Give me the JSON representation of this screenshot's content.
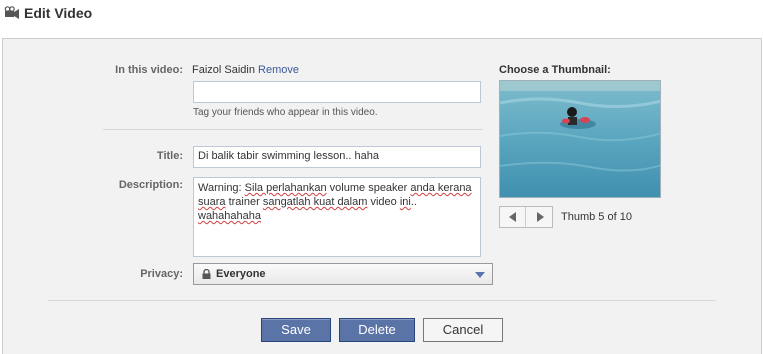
{
  "header": {
    "title": "Edit Video",
    "icon": "video-camera-icon"
  },
  "tagging": {
    "label": "In this video:",
    "tagged_name": "Faizol Saidin",
    "remove_link": "Remove",
    "input_value": "",
    "hint": "Tag your friends who appear in this video."
  },
  "title_field": {
    "label": "Title:",
    "value": "Di balik tabir swimming lesson.. haha"
  },
  "description_field": {
    "label": "Description:",
    "line1_a": "Warning: ",
    "line1_b": "Sila perlahankan",
    "line1_c": " volume speaker ",
    "line1_d": "anda kerana",
    "line2_a": "suara",
    "line2_b": " trainer ",
    "line2_c": "sangatlah kuat dalam",
    "line2_d": " video ",
    "line2_e": "ini",
    "line2_f": "..",
    "line3": "wahahahaha"
  },
  "privacy": {
    "label": "Privacy:",
    "selected": "Everyone",
    "icon": "lock-icon"
  },
  "thumbnail": {
    "title": "Choose a Thumbnail:",
    "counter": "Thumb 5 of 10",
    "prev_icon": "arrow-left-icon",
    "next_icon": "arrow-right-icon"
  },
  "actions": {
    "save": "Save",
    "delete": "Delete",
    "cancel": "Cancel"
  },
  "colors": {
    "brand_blue": "#5b74a8",
    "link_blue": "#3b5998",
    "panel_bg": "#f2f2f2",
    "pool_water": "#5fa8c0"
  }
}
